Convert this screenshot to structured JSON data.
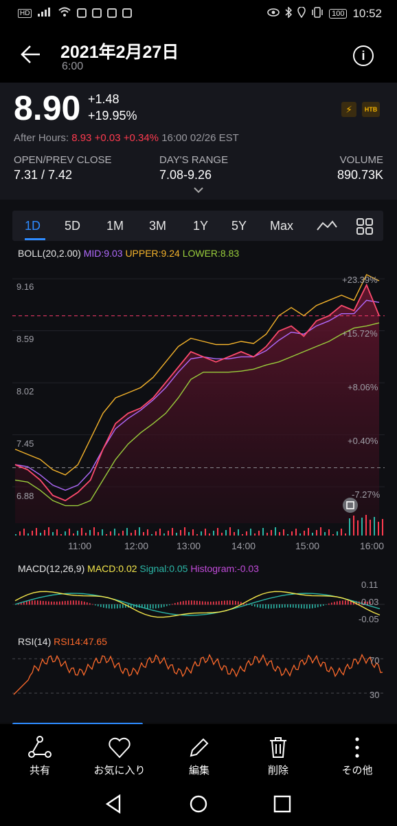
{
  "status_bar": {
    "time": "10:52",
    "battery": "100",
    "hd": "HD"
  },
  "header": {
    "title": "2021年2月27日",
    "subtitle": "6:00"
  },
  "quote": {
    "price": "8.90",
    "change": "+1.48",
    "change_pct": "+19.95%",
    "after_hours_label": "After Hours:",
    "after_hours_price": "8.93",
    "after_hours_change": "+0.03",
    "after_hours_pct": "+0.34%",
    "after_hours_time": "16:00 02/26 EST",
    "badge_htb": "HTB",
    "open_prev_label": "OPEN/PREV CLOSE",
    "open_prev_value": "7.31 / 7.42",
    "day_range_label": "DAY'S RANGE",
    "day_range_value": "7.08-9.26",
    "volume_label": "VOLUME",
    "volume_value": "890.73K"
  },
  "tabs": [
    "1D",
    "5D",
    "1M",
    "3M",
    "1Y",
    "5Y",
    "Max"
  ],
  "active_tab": "1D",
  "boll": {
    "label": "BOLL(20,2.00)",
    "mid": "MID:9.03",
    "upper": "UPPER:9.24",
    "lower": "LOWER:8.83"
  },
  "macd": {
    "label": "MACD(12,26,9)",
    "macd": "MACD:0.02",
    "signal": "Signal:0.05",
    "histogram": "Histogram:-0.03",
    "axis": [
      "0.11",
      "0.03",
      "-0.05"
    ]
  },
  "rsi": {
    "label": "RSI(14)",
    "value": "RSI14:47.65",
    "axis": [
      "70",
      "30"
    ]
  },
  "colors": {
    "price_line": "#ff4b6e",
    "boll_mid": "#b26bff",
    "boll_upper": "#f6b42b",
    "boll_lower": "#9bcf3c",
    "accent": "#2e8bff",
    "up": "#ff3b4f"
  },
  "chart_data": {
    "type": "line",
    "x_ticks": [
      "11:00",
      "12:00",
      "13:00",
      "14:00",
      "15:00",
      "16:00"
    ],
    "y_ticks": [
      "9.16",
      "8.59",
      "8.02",
      "7.45",
      "6.88"
    ],
    "pct_ticks": [
      "+23.39%",
      "+15.72%",
      "+8.06%",
      "+0.40%",
      "-7.27%"
    ],
    "ylim": [
      6.88,
      9.26
    ],
    "price": [
      7.45,
      7.4,
      7.3,
      7.15,
      7.1,
      7.18,
      7.3,
      7.6,
      7.85,
      7.95,
      8.0,
      8.1,
      8.25,
      8.4,
      8.55,
      8.5,
      8.45,
      8.5,
      8.55,
      8.5,
      8.6,
      8.75,
      8.8,
      8.7,
      8.85,
      8.9,
      9.0,
      8.95,
      9.2,
      8.9
    ],
    "upper": [
      7.6,
      7.55,
      7.5,
      7.4,
      7.35,
      7.45,
      7.7,
      7.95,
      8.1,
      8.15,
      8.2,
      8.3,
      8.45,
      8.6,
      8.68,
      8.65,
      8.62,
      8.62,
      8.65,
      8.63,
      8.72,
      8.9,
      8.98,
      8.9,
      9.0,
      9.05,
      9.1,
      9.05,
      9.3,
      9.24
    ],
    "mid": [
      7.45,
      7.43,
      7.35,
      7.25,
      7.2,
      7.25,
      7.38,
      7.6,
      7.8,
      7.9,
      7.98,
      8.08,
      8.2,
      8.35,
      8.48,
      8.5,
      8.48,
      8.48,
      8.5,
      8.5,
      8.56,
      8.66,
      8.74,
      8.72,
      8.8,
      8.85,
      8.92,
      8.92,
      9.05,
      9.03
    ],
    "lower": [
      7.3,
      7.28,
      7.2,
      7.1,
      7.05,
      7.05,
      7.1,
      7.3,
      7.5,
      7.65,
      7.76,
      7.85,
      7.95,
      8.1,
      8.28,
      8.35,
      8.35,
      8.35,
      8.36,
      8.38,
      8.42,
      8.45,
      8.5,
      8.55,
      8.6,
      8.65,
      8.72,
      8.78,
      8.8,
      8.83
    ]
  },
  "bottom_nav": [
    "共有",
    "お気に入り",
    "編集",
    "削除",
    "その他"
  ]
}
